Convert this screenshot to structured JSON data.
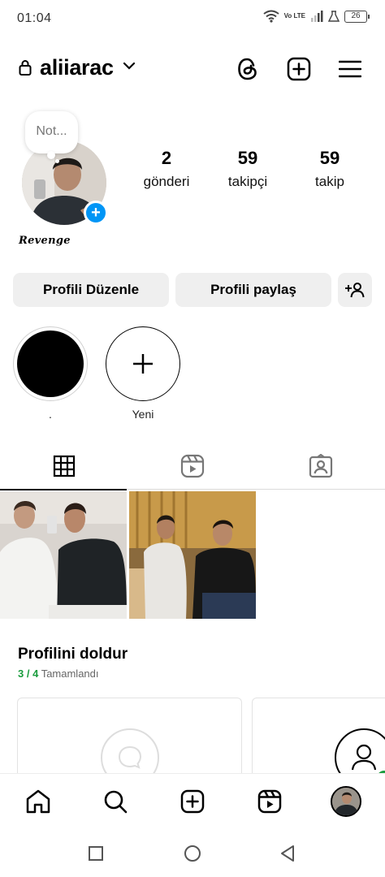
{
  "status_bar": {
    "time": "01:04",
    "network": "Vo LTE",
    "battery": "26"
  },
  "header": {
    "username": "aliiarac"
  },
  "profile": {
    "note_placeholder": "Not...",
    "bio_name": "Revenge",
    "stats": [
      {
        "value": "2",
        "label": "gönderi"
      },
      {
        "value": "59",
        "label": "takipçi"
      },
      {
        "value": "59",
        "label": "takip"
      }
    ]
  },
  "buttons": {
    "edit_profile": "Profili Düzenle",
    "share_profile": "Profili paylaş"
  },
  "highlights": [
    {
      "label": "."
    },
    {
      "label": "Yeni"
    }
  ],
  "tabs": [
    "grid-icon",
    "reels-icon",
    "tagged-icon"
  ],
  "complete_profile": {
    "title": "Profilini doldur",
    "progress": "3 / 4",
    "progress_suffix": "Tamamlandı"
  },
  "colors": {
    "accent": "#0095f6",
    "progress_green": "#1a9c3e",
    "button_bg": "#efefef"
  }
}
